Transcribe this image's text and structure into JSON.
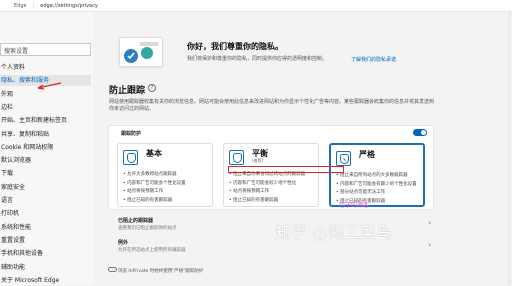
{
  "topbar": {
    "browser": "Edge",
    "url": "edge://settings/privacy"
  },
  "sidebar": {
    "search_placeholder": "搜索设置",
    "items": [
      {
        "label": "个人资料",
        "active": false
      },
      {
        "label": "隐私、搜索和服务",
        "active": true
      },
      {
        "label": "外观",
        "active": false
      },
      {
        "label": "边栏",
        "active": false
      },
      {
        "label": "开始、主页和新建标签页",
        "active": false
      },
      {
        "label": "共享、复制和粘贴",
        "active": false
      },
      {
        "label": "Cookie 和网站权限",
        "active": false
      },
      {
        "label": "默认浏览器",
        "active": false
      },
      {
        "label": "下载",
        "active": false
      },
      {
        "label": "家庭安全",
        "active": false
      },
      {
        "label": "语言",
        "active": false
      },
      {
        "label": "打印机",
        "active": false
      },
      {
        "label": "系统和性能",
        "active": false
      },
      {
        "label": "重置设置",
        "active": false
      },
      {
        "label": "手机和其他设备",
        "active": false
      },
      {
        "label": "辅助功能",
        "active": false
      },
      {
        "label": "关于 Microsoft Edge",
        "active": false
      }
    ]
  },
  "hero": {
    "title": "你好，我们尊重你的隐私。",
    "description": "我们将保护和尊重你的隐私，同时提供你应得的透明度和控制。",
    "link": "了解我们的隐私承诺"
  },
  "tracking": {
    "title": "防止跟踪",
    "intro": "网站使用跟踪器收集有关你的浏览信息。网站可能会使用此信息来改进网站和为你显示个性化广告等内容。某些跟踪器会收集你的信息并将其发送到你未访问过的网站。",
    "panel_label": "跟踪防护",
    "cards": [
      {
        "title": "基本",
        "subtitle": "",
        "bullets": [
          "允许大多数跨站点跟踪器",
          "内容和广告可能会个性化设置",
          "站点将按预期工作",
          "阻止已知的有害跟踪器"
        ]
      },
      {
        "title": "平衡",
        "subtitle": "(推荐)",
        "bullets": [
          "阻止来自你未访问过的站点的跟踪器",
          "内容和广告可能会较少地个性化",
          "站点将按预期工作",
          "阻止已知的有害跟踪器"
        ]
      },
      {
        "title": "严格",
        "subtitle": "",
        "bullets": [
          "阻止来自所有站点的大多数跟踪器",
          "内容和广告可能会有最少的个性化设置",
          "部分站点可能无法工作",
          "阻止已知的有害跟踪器"
        ]
      }
    ],
    "blocked_row": {
      "title": "已阻止的跟踪器",
      "desc": "查看我们已阻止跟踪你的站点"
    },
    "exceptions_row": {
      "title": "例外",
      "desc": "允许在所选站点上使用所有跟踪器"
    },
    "inprivate_text": "浏览 InPrivate 时始终使用\"严格\"跟踪防护"
  },
  "watermark": {
    "main": "知乎 @网工菜鸟",
    "small": "包子的博客"
  },
  "colors": {
    "accent": "#0067c0",
    "highlight_border": "#d22222",
    "selected_card": "#1f6fb2"
  }
}
